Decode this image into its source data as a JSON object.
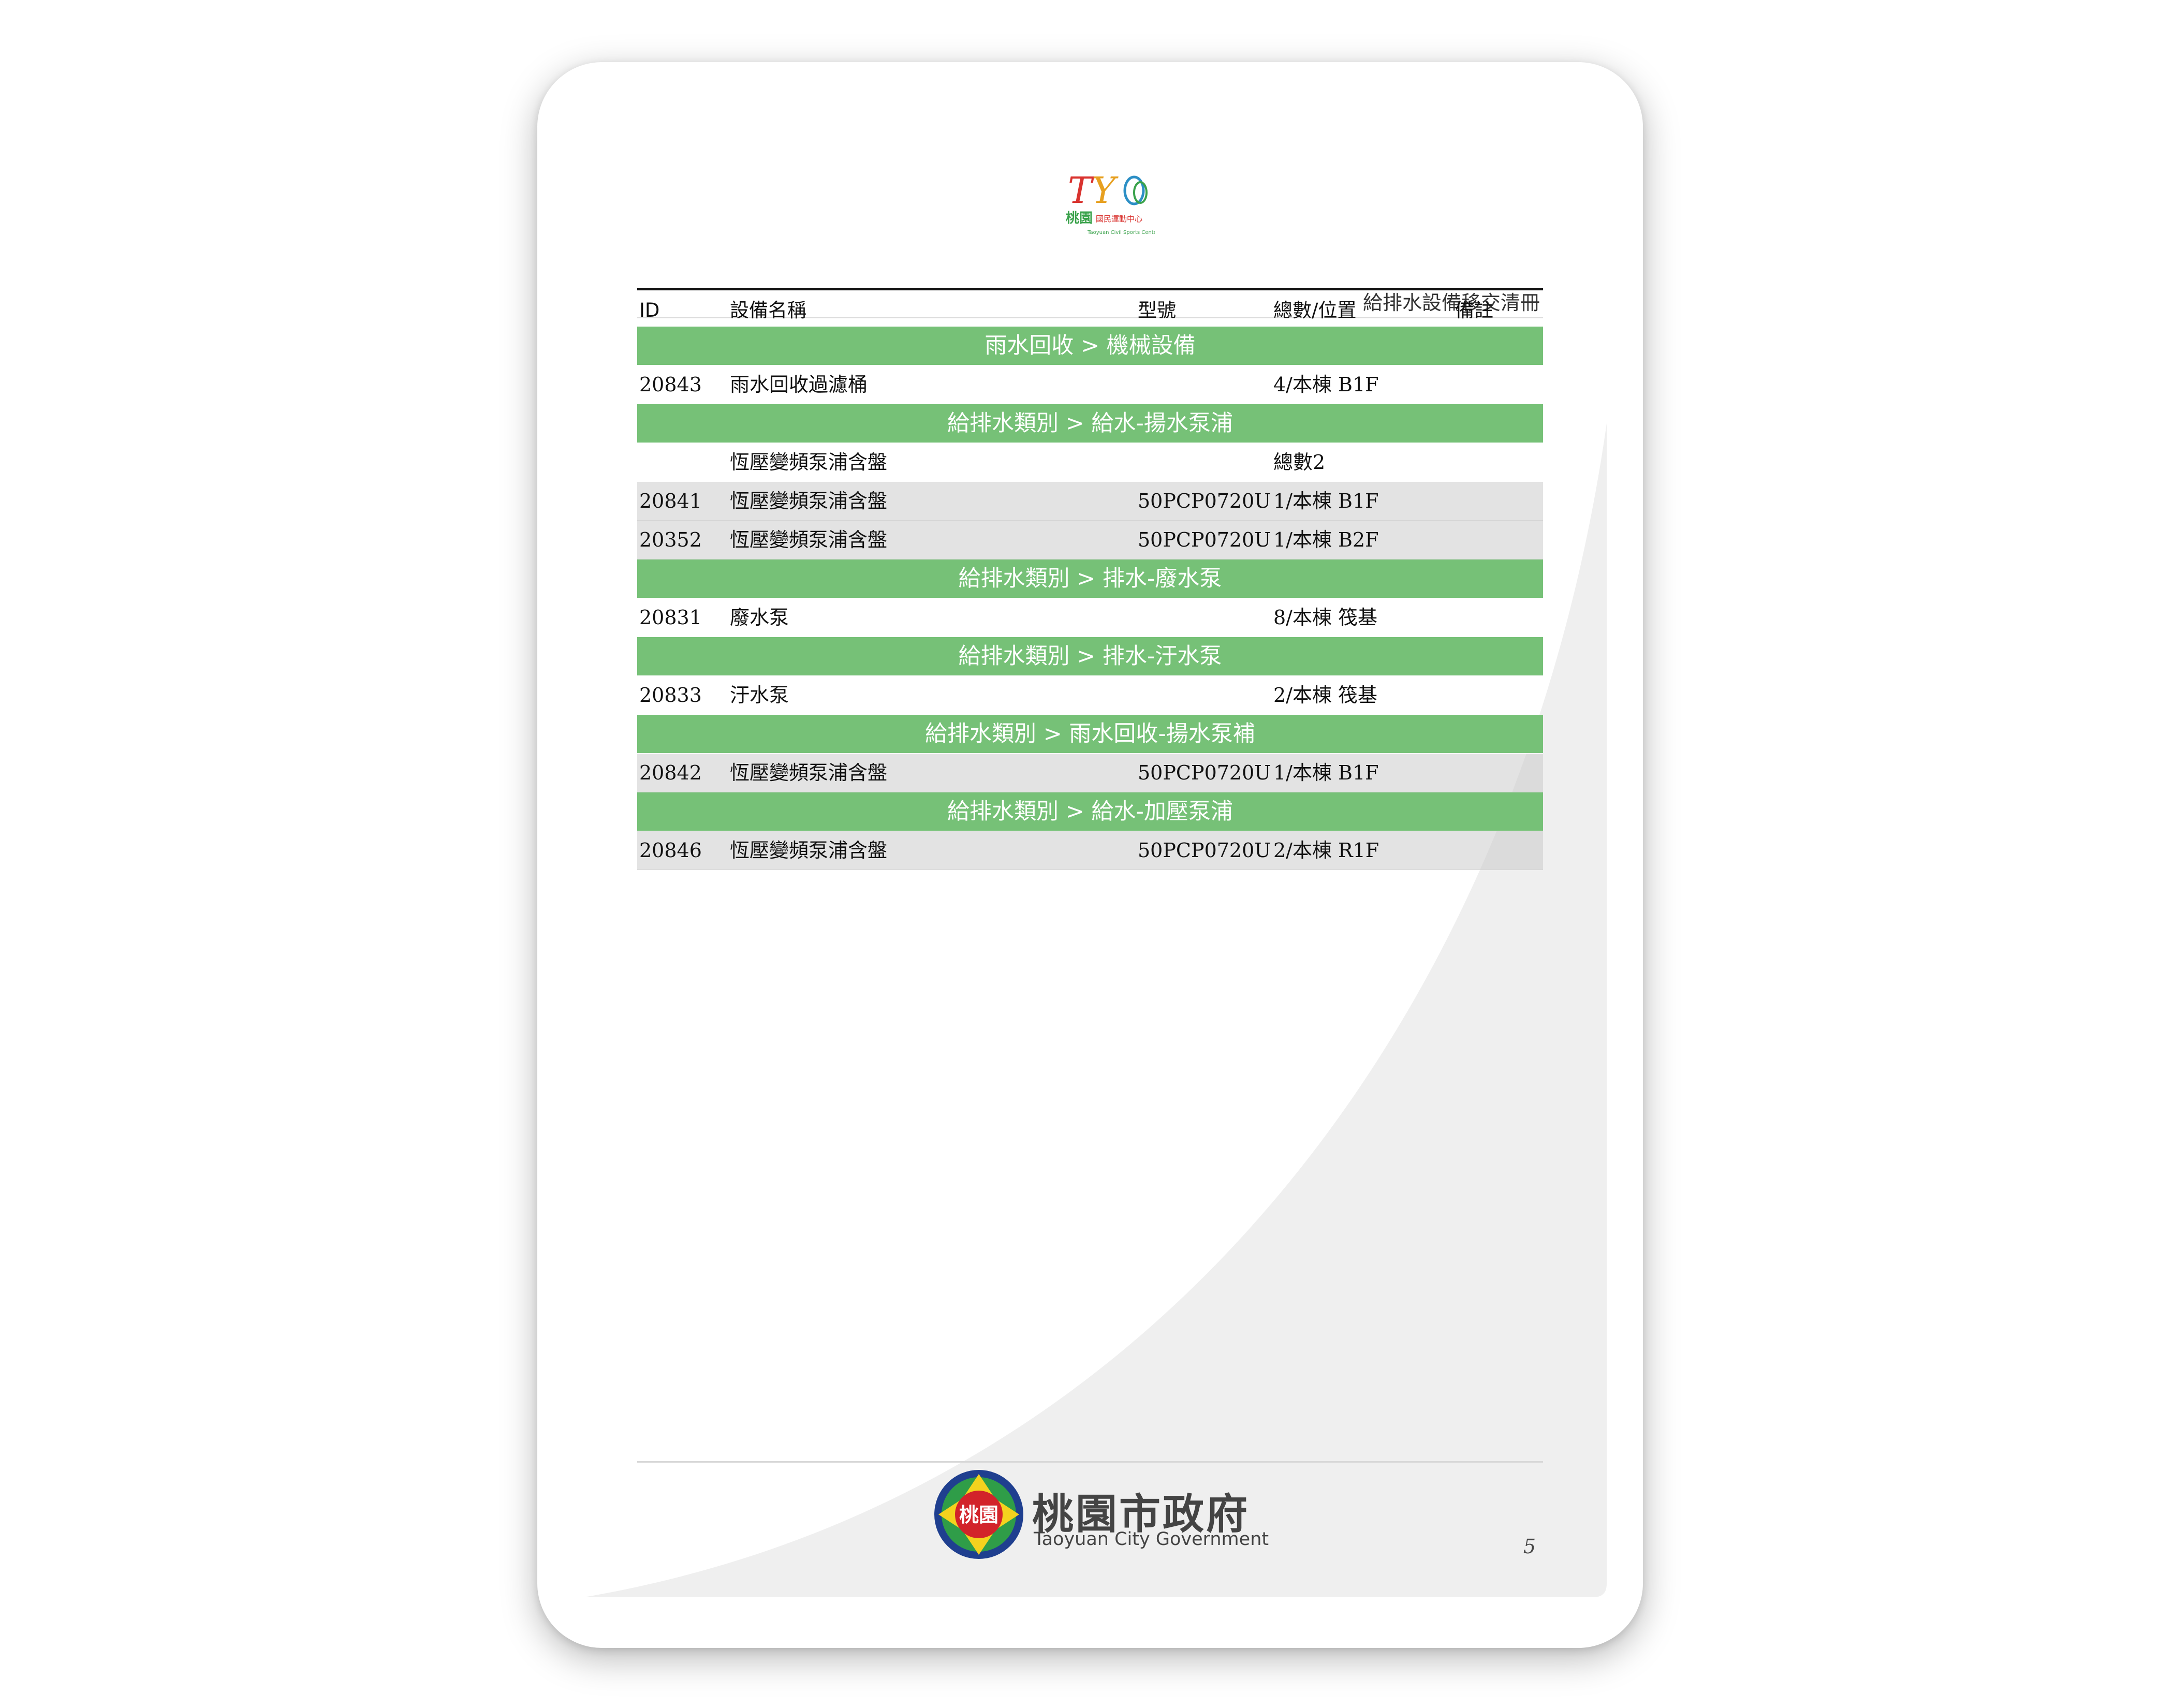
{
  "document": {
    "title": "給排水設備移交清冊",
    "page_number": "5"
  },
  "header_logo": {
    "icon": "tycsc-logo-icon",
    "text": "TY 桃園國民運動中心 Taoyuan Civil Sports Center",
    "colors": [
      "#d9332f",
      "#e7a020",
      "#3aa24b",
      "#2c8fc5"
    ]
  },
  "table": {
    "columns": [
      "ID",
      "設備名稱",
      "型號",
      "總數/位置",
      "備註"
    ],
    "sections": [
      {
        "title": "雨水回收 > 機械設備",
        "rows": [
          {
            "id": "20843",
            "name": "雨水回收過濾桶",
            "model": "",
            "location": "4/本棟 B1F",
            "note": "",
            "shaded": false
          }
        ]
      },
      {
        "title": "給排水類別 > 給水-揚水泵浦",
        "rows": [
          {
            "id": "",
            "name": "恆壓變頻泵浦含盤",
            "model": "",
            "location": "總數2",
            "note": "",
            "shaded": false
          },
          {
            "id": "20841",
            "name": "恆壓變頻泵浦含盤",
            "model": "50PCP0720U",
            "location": "1/本棟 B1F",
            "note": "",
            "shaded": true
          },
          {
            "id": "20352",
            "name": "恆壓變頻泵浦含盤",
            "model": "50PCP0720U",
            "location": "1/本棟 B2F",
            "note": "",
            "shaded": true
          }
        ]
      },
      {
        "title": "給排水類別 > 排水-廢水泵",
        "rows": [
          {
            "id": "20831",
            "name": "廢水泵",
            "model": "",
            "location": "8/本棟 筏基",
            "note": "",
            "shaded": false
          }
        ]
      },
      {
        "title": "給排水類別 > 排水-汙水泵",
        "rows": [
          {
            "id": "20833",
            "name": "汙水泵",
            "model": "",
            "location": "2/本棟 筏基",
            "note": "",
            "shaded": false
          }
        ]
      },
      {
        "title": "給排水類別 > 雨水回收-揚水泵補",
        "rows": [
          {
            "id": "20842",
            "name": "恆壓變頻泵浦含盤",
            "model": "50PCP0720U",
            "location": "1/本棟 B1F",
            "note": "",
            "shaded": true
          }
        ]
      },
      {
        "title": "給排水類別 > 給水-加壓泵浦",
        "rows": [
          {
            "id": "20846",
            "name": "恆壓變頻泵浦含盤",
            "model": "50PCP0720U",
            "location": "2/本棟 R1F",
            "note": "",
            "shaded": true
          }
        ]
      }
    ]
  },
  "footer": {
    "gov_name": "桃園市政府",
    "gov_name_en": "Taoyuan City Government",
    "seal_text": "桃園",
    "seal_icon": "taoyuan-seal-icon"
  },
  "colors": {
    "section_green": "#76c177",
    "row_shade": "#dcdcdc",
    "seal_blue": "#1f3f8f",
    "seal_red": "#d2232a",
    "seal_yellow": "#f4d21e",
    "seal_green": "#2f9d48"
  }
}
